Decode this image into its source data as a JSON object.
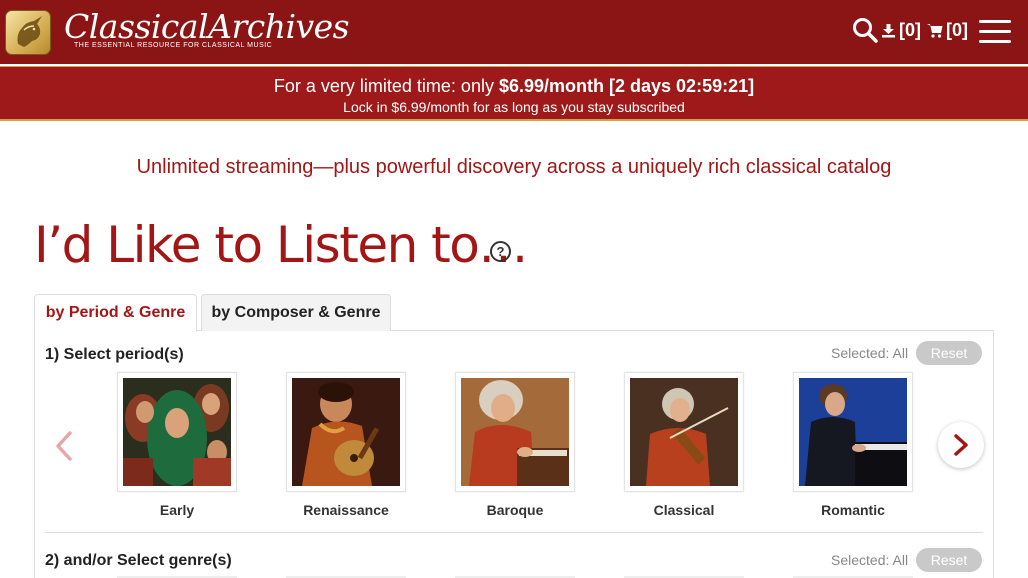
{
  "header": {
    "brand_name": "ClassicalArchives",
    "brand_tagline": "THE ESSENTIAL RESOURCE FOR CLASSICAL MUSIC",
    "icons": [
      "unicorn-logo-icon",
      "search-icon",
      "download-icon",
      "cart-icon",
      "menu-icon"
    ],
    "downloads_count": "[0]",
    "cart_count": "[0]"
  },
  "promo": {
    "lead": "For a very limited time: only",
    "price": "$6.99/month",
    "countdown": "[2 days 02:59:21]",
    "subline": "Lock in $6.99/month for as long as you stay subscribed"
  },
  "tagline": "Unlimited streaming—plus powerful discovery across a uniquely rich classical catalog",
  "page_title": "I’d Like to Listen to…",
  "help_glyph": "?",
  "tabs": [
    {
      "label": "by Period & Genre",
      "active": true
    },
    {
      "label": "by Composer & Genre",
      "active": false
    }
  ],
  "section1": {
    "heading": "1) Select period(s)",
    "selected": "Selected: All",
    "reset": "Reset",
    "periods": [
      {
        "label": "Early"
      },
      {
        "label": "Renaissance"
      },
      {
        "label": "Baroque"
      },
      {
        "label": "Classical"
      },
      {
        "label": "Romantic"
      }
    ]
  },
  "section2": {
    "heading": "2) and/or Select genre(s)",
    "selected": "Selected: All",
    "reset": "Reset"
  },
  "colors": {
    "brand_red": "#8b1515",
    "accent_red": "#a31616",
    "gold": "#d4a04a"
  }
}
